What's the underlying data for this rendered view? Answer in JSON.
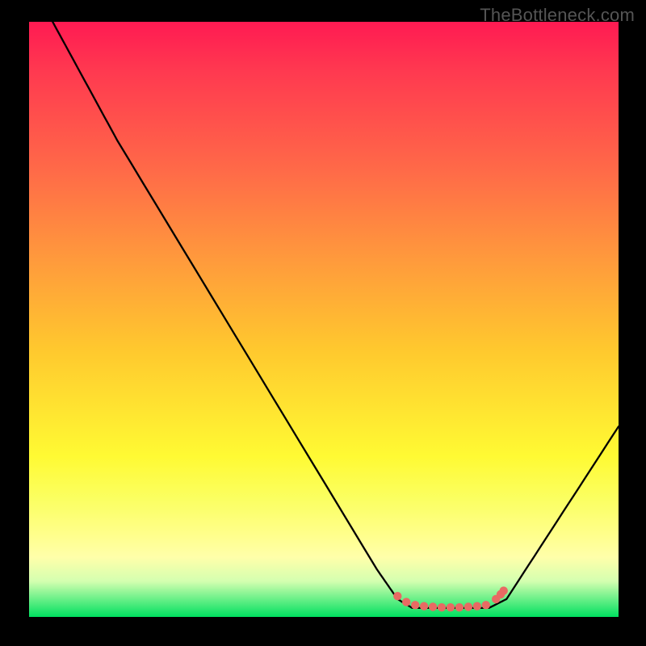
{
  "watermark": "TheBottleneck.com",
  "chart_data": {
    "type": "line",
    "title": "",
    "xlabel": "",
    "ylabel": "",
    "xlim": [
      0,
      100
    ],
    "ylim": [
      0,
      100
    ],
    "curve": {
      "name": "bottleneck-curve",
      "points": [
        {
          "x": 4,
          "y": 100
        },
        {
          "x": 15,
          "y": 80
        },
        {
          "x": 59,
          "y": 8
        },
        {
          "x": 62.5,
          "y": 3
        },
        {
          "x": 65,
          "y": 1.5
        },
        {
          "x": 78,
          "y": 1.5
        },
        {
          "x": 81,
          "y": 3
        },
        {
          "x": 100,
          "y": 32
        }
      ]
    },
    "markers_valley": {
      "color": "#e86a63",
      "points": [
        {
          "x": 62.5,
          "y": 3.5
        },
        {
          "x": 64,
          "y": 2.5
        },
        {
          "x": 65.5,
          "y": 2.0
        },
        {
          "x": 67,
          "y": 1.8
        },
        {
          "x": 68.5,
          "y": 1.7
        },
        {
          "x": 70,
          "y": 1.6
        },
        {
          "x": 71.5,
          "y": 1.6
        },
        {
          "x": 73,
          "y": 1.6
        },
        {
          "x": 74.5,
          "y": 1.7
        },
        {
          "x": 76,
          "y": 1.8
        },
        {
          "x": 77.5,
          "y": 2.0
        },
        {
          "x": 79.2,
          "y": 3.0
        },
        {
          "x": 80.0,
          "y": 3.8
        },
        {
          "x": 80.5,
          "y": 4.4
        }
      ]
    }
  }
}
